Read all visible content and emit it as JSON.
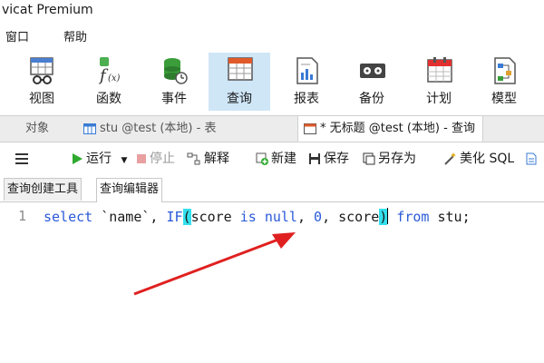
{
  "app": {
    "title": "vicat Premium"
  },
  "menu": {
    "items": [
      "窗口",
      "帮助"
    ]
  },
  "ribbon": {
    "buttons": [
      {
        "label": "视图",
        "icon": "view-grid-icon"
      },
      {
        "label": "函数",
        "icon": "function-icon"
      },
      {
        "label": "事件",
        "icon": "event-icon"
      },
      {
        "label": "查询",
        "icon": "query-icon",
        "active": true
      },
      {
        "label": "报表",
        "icon": "report-icon"
      },
      {
        "label": "备份",
        "icon": "backup-icon"
      },
      {
        "label": "计划",
        "icon": "schedule-icon"
      },
      {
        "label": "模型",
        "icon": "model-icon"
      }
    ]
  },
  "tabs": [
    {
      "label": "对象"
    },
    {
      "label": "stu @test (本地) - 表"
    },
    {
      "label": "* 无标题 @test (本地) - 查询",
      "active": true
    }
  ],
  "toolbar": {
    "menu_icon": "hamburger-icon",
    "run": "运行",
    "stop": "停止",
    "explain": "解释",
    "new": "新建",
    "save": "保存",
    "save_as": "另存为",
    "beautify": "美化 SQL"
  },
  "subtabs": [
    {
      "label": "查询创建工具"
    },
    {
      "label": "查询编辑器",
      "active": true
    }
  ],
  "editor": {
    "line_number": "1",
    "tokens": {
      "select": "select",
      "col": " `name`, ",
      "if": "IF",
      "lparen": "(",
      "score1": "score ",
      "is": "is",
      "space1": " ",
      "null": "null",
      "comma1": ", ",
      "zero": "0",
      "comma2": ", score",
      "rparen": ")",
      "space2": " ",
      "from": "from",
      "tail": " stu;"
    }
  },
  "colors": {
    "accent": "#cfe6f7",
    "keyword": "#2a5ad8",
    "bracket_highlight": "#33e0ee",
    "arrow": "#e02020"
  }
}
